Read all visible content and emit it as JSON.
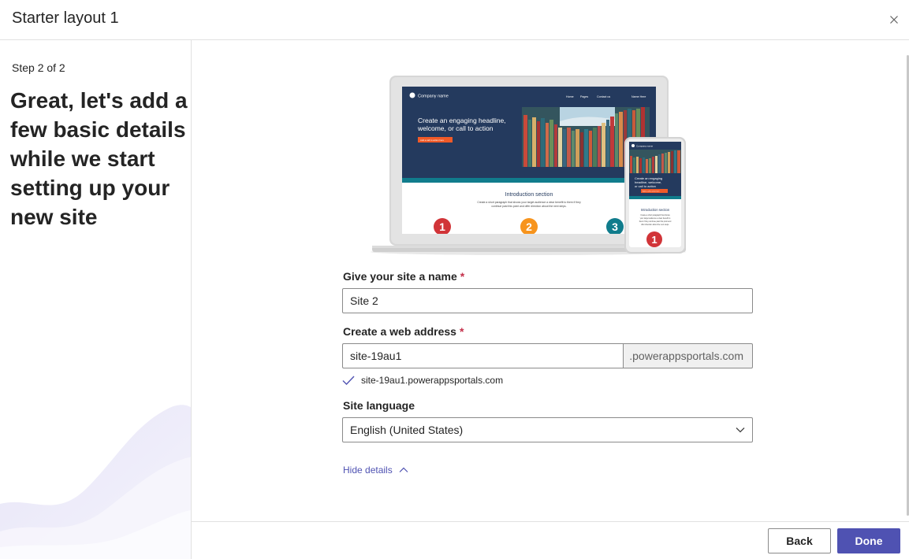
{
  "header": {
    "title": "Starter layout 1",
    "close_icon": "close-icon"
  },
  "left_panel": {
    "step": "Step 2 of 2",
    "headline": "Great, let's add a few basic details while we start setting up your new site"
  },
  "illustration": {
    "laptop": {
      "company_name": "Company name",
      "nav": [
        "Home",
        "Pages",
        "Contact us",
        "Name Here"
      ],
      "hero_headline_line1": "Create an engaging headline,",
      "hero_headline_line2": "welcome, or call to action",
      "cta": "Add a call to action here",
      "intro_title": "Introduction section",
      "intro_line1": "Create a short paragraph that shows your target audience a clear benefit to them if they",
      "intro_line2": "continue past this point and offer direction about the next steps.",
      "steps": [
        "1",
        "2",
        "3"
      ]
    },
    "phone": {
      "company_name": "Company name",
      "hero_line1": "Create an engaging",
      "hero_line2": "headline, welcome,",
      "hero_line3": "or call to action",
      "cta": "Add a call to action here",
      "intro_title": "Introduction section",
      "intro_l1": "Create a short paragraph that shows",
      "intro_l2": "your target audience a clear benefit to",
      "intro_l3": "them if they continue past this point and",
      "intro_l4": "offer direction about the next steps.",
      "step": "1"
    },
    "colors": {
      "hero": "#243a5e",
      "step1": "#d13438",
      "step2": "#f7941d",
      "step3": "#107c8c"
    }
  },
  "form": {
    "name_label": "Give your site a name",
    "name_value": "Site 2",
    "address_label": "Create a web address",
    "address_value": "site-19au1",
    "address_suffix": ".powerappsportals.com",
    "address_check": "site-19au1.powerappsportals.com",
    "required_mark": "*",
    "language_label": "Site language",
    "language_value": "English (United States)",
    "hide_details": "Hide details"
  },
  "footer": {
    "back": "Back",
    "done": "Done"
  },
  "colors": {
    "accent": "#4f52b2",
    "required": "#c4314b"
  }
}
